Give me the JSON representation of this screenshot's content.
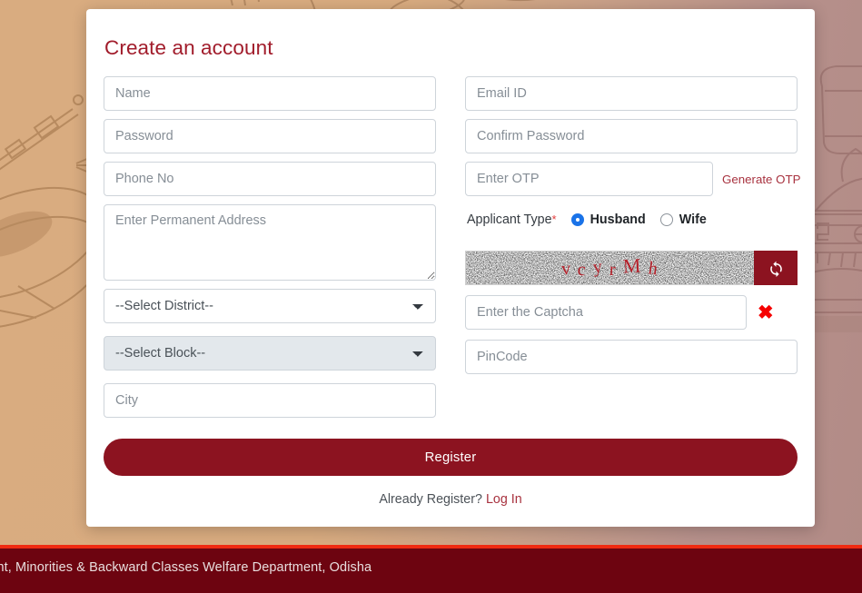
{
  "card": {
    "title": "Create an account",
    "left_fields": [
      {
        "name": "name",
        "placeholder": "Name",
        "type": "text"
      },
      {
        "name": "password",
        "placeholder": "Password",
        "type": "password"
      },
      {
        "name": "phone",
        "placeholder": "Phone No",
        "type": "text"
      }
    ],
    "address": {
      "placeholder": "Enter Permanent Address"
    },
    "district": {
      "selected": "--Select District--",
      "options": [
        "--Select District--"
      ]
    },
    "block": {
      "selected": "--Select Block--",
      "options": [
        "--Select Block--"
      ],
      "disabled": true
    },
    "city": {
      "placeholder": "City"
    },
    "email": {
      "placeholder": "Email ID"
    },
    "confirm_password": {
      "placeholder": "Confirm Password"
    },
    "otp": {
      "placeholder": "Enter OTP",
      "link_label": "Generate OTP"
    },
    "applicant_type": {
      "label": "Applicant Type",
      "required_mark": "*",
      "options": [
        {
          "label": "Husband",
          "checked": true
        },
        {
          "label": "Wife",
          "checked": false
        }
      ]
    },
    "captcha": {
      "text": "vcyrMh",
      "refresh_icon": "refresh-icon",
      "input_placeholder": "Enter the Captcha",
      "status_icon": "cross-mark-icon",
      "status_symbol": "✖"
    },
    "pincode": {
      "placeholder": "PinCode"
    },
    "register_label": "Register",
    "already_text": "Already Register?",
    "login_label": "Log In"
  },
  "footer": {
    "text": "oment, Minorities & Backward Classes Welfare Department, Odisha"
  },
  "colors": {
    "brand_red": "#8c1320",
    "title_red": "#a11c2b",
    "link_red": "#a8323f",
    "footer_bg": "#6d0410",
    "footer_rule": "#ef2b12",
    "bg_left": "#d9ac80",
    "bg_right": "#b28b86",
    "radio_blue": "#1a73e8",
    "error_red": "#f50000"
  }
}
